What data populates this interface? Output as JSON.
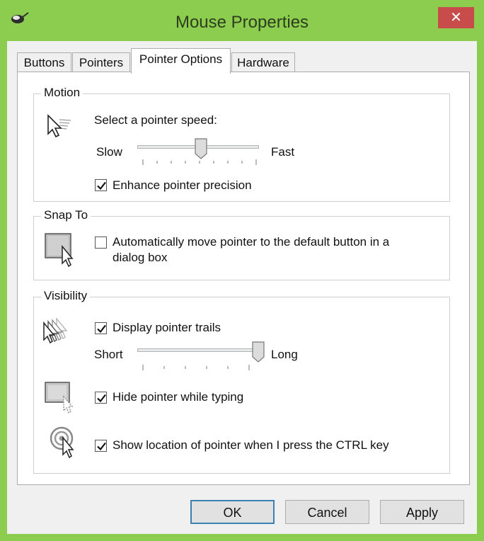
{
  "window": {
    "title": "Mouse Properties",
    "close_glyph": "✕"
  },
  "tabs": [
    {
      "label": "Buttons"
    },
    {
      "label": "Pointers"
    },
    {
      "label": "Pointer Options"
    },
    {
      "label": "Hardware"
    }
  ],
  "motion": {
    "group_label": "Motion",
    "speed_label": "Select a pointer speed:",
    "slow_label": "Slow",
    "fast_label": "Fast",
    "speed_level": 0.5,
    "enhance_precision": {
      "label": "Enhance pointer precision",
      "checked": true
    }
  },
  "snap_to": {
    "group_label": "Snap To",
    "auto_move": {
      "label_line1": "Automatically move pointer to the default button in a",
      "label_line2": "dialog box",
      "checked": false
    }
  },
  "visibility": {
    "group_label": "Visibility",
    "trails": {
      "label": "Display pointer trails",
      "checked": true
    },
    "short_label": "Short",
    "long_label": "Long",
    "trail_level": 1.0,
    "hide_typing": {
      "label": "Hide pointer while typing",
      "checked": true
    },
    "show_ctrl": {
      "label": "Show location of pointer when I press the CTRL key",
      "checked": true
    }
  },
  "buttons": {
    "ok": "OK",
    "cancel": "Cancel",
    "apply": "Apply"
  },
  "colors": {
    "title_bar": "#8ccd50",
    "close_button": "#c74c4a",
    "default_button_border": "#3c7fb1"
  }
}
